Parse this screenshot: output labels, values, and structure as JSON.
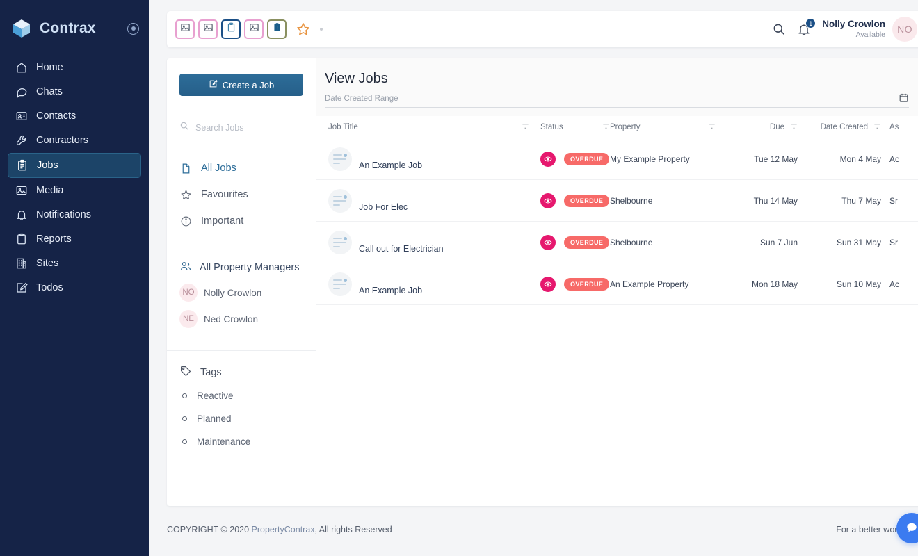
{
  "sidebar": {
    "brand": {
      "name": "Contrax",
      "logo_icon": "cube-logo-icon",
      "target_icon": "target-icon"
    },
    "items": [
      {
        "label": "Home",
        "icon": "home-icon",
        "active": false
      },
      {
        "label": "Chats",
        "icon": "chat-bubble-icon",
        "active": false
      },
      {
        "label": "Contacts",
        "icon": "contact-card-icon",
        "active": false
      },
      {
        "label": "Contractors",
        "icon": "wrench-icon",
        "active": false
      },
      {
        "label": "Jobs",
        "icon": "clipboard-list-icon",
        "active": true
      },
      {
        "label": "Media",
        "icon": "image-icon",
        "active": false
      },
      {
        "label": "Notifications",
        "icon": "bell-icon",
        "active": false
      },
      {
        "label": "Reports",
        "icon": "clipboard-icon",
        "active": false
      },
      {
        "label": "Sites",
        "icon": "building-icon",
        "active": false
      },
      {
        "label": "Todos",
        "icon": "edit-square-icon",
        "active": false
      }
    ]
  },
  "topbar": {
    "tools": [
      {
        "name": "image-tool-1",
        "icon": "image-icon",
        "border_color": "#e8a0d0"
      },
      {
        "name": "image-tool-2",
        "icon": "image-icon",
        "border_color": "#e8a0d0"
      },
      {
        "name": "clipboard-tool",
        "icon": "clipboard-icon",
        "border_color": "#1b4f86"
      },
      {
        "name": "image-tool-3",
        "icon": "image-icon",
        "border_color": "#e8a0d0"
      },
      {
        "name": "clipboard-info-tool",
        "icon": "clipboard-info-icon",
        "border_color": "#8a9060"
      }
    ],
    "star_icon": "star-icon",
    "search_icon": "search-icon",
    "bell_icon": "bell-icon",
    "notification_count": "1",
    "user": {
      "name": "Nolly Crowlon",
      "status": "Available",
      "initials": "NO"
    }
  },
  "filters": {
    "create_button": {
      "label": "Create a Job",
      "icon": "edit-icon"
    },
    "search": {
      "placeholder": "Search Jobs",
      "value": "",
      "icon": "search-icon"
    },
    "views": [
      {
        "label": "All Jobs",
        "icon": "file-icon",
        "active": true
      },
      {
        "label": "Favourites",
        "icon": "star-icon",
        "active": false
      },
      {
        "label": "Important",
        "icon": "info-circle-icon",
        "active": false
      }
    ],
    "property_managers": {
      "header": "All Property Managers",
      "header_icon": "people-icon",
      "people": [
        {
          "name": "Nolly Crowlon",
          "initials": "NO"
        },
        {
          "name": "Ned Crowlon",
          "initials": "NE"
        }
      ]
    },
    "tags": {
      "header": "Tags",
      "header_icon": "tag-icon",
      "items": [
        {
          "label": "Reactive"
        },
        {
          "label": "Planned"
        },
        {
          "label": "Maintenance"
        }
      ]
    }
  },
  "jobs_view": {
    "title": "View Jobs",
    "date_range": {
      "placeholder": "Date Created Range",
      "value": "",
      "calendar_icon": "calendar-icon"
    },
    "columns": [
      {
        "label": "Job Title",
        "filter_icon": "filter-icon"
      },
      {
        "label": "Status",
        "filter_icon": "filter-icon"
      },
      {
        "label": "Property",
        "filter_icon": "filter-icon"
      },
      {
        "label": "Due",
        "filter_icon": "filter-icon"
      },
      {
        "label": "Date Created",
        "filter_icon": "filter-icon"
      },
      {
        "label": "As",
        "filter_icon": ""
      }
    ],
    "rows": [
      {
        "job_title": "An Example Job",
        "status": "OVERDUE",
        "eye_icon": "eye-icon",
        "property": "My Example Property",
        "due": "Tue 12 May",
        "date_created": "Mon 4 May",
        "assigned": "Ac"
      },
      {
        "job_title": "Job For Elec",
        "status": "OVERDUE",
        "eye_icon": "eye-icon",
        "property": "Shelbourne",
        "due": "Thu 14 May",
        "date_created": "Thu 7 May",
        "assigned": "Sr"
      },
      {
        "job_title": "Call out for Electrician",
        "status": "OVERDUE",
        "eye_icon": "eye-icon",
        "property": "Shelbourne",
        "due": "Sun 7 Jun",
        "date_created": "Sun 31 May",
        "assigned": "Sr"
      },
      {
        "job_title": "An Example Job",
        "status": "OVERDUE",
        "eye_icon": "eye-icon",
        "property": "An Example Property",
        "due": "Mon 18 May",
        "date_created": "Sun 10 May",
        "assigned": "Ac"
      }
    ]
  },
  "footer": {
    "copyright_prefix": "COPYRIGHT © 2020 ",
    "brand_link": "PropertyContrax",
    "copyright_suffix": ", All rights Reserved",
    "tagline": "For a better working day",
    "chat_icon": "chat-bubble-icon"
  },
  "colors": {
    "sidebar_bg": "#152347",
    "accent_blue": "#2d6d99",
    "active_nav_bg": "#1c4468",
    "status_pill": "#f76a68",
    "eye_badge": "#e6186e",
    "chat_fab": "#3b7bf0",
    "tool_pink": "#e8a0d0",
    "tool_blue": "#1b4f86",
    "tool_olive": "#8a9060",
    "star_orange": "#e8933f"
  }
}
